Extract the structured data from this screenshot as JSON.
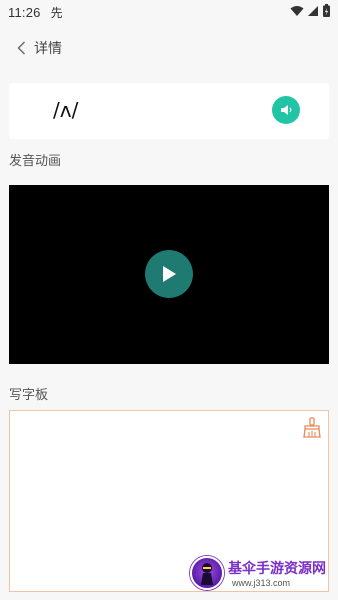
{
  "status": {
    "time": "11:26",
    "app_glyph": "先"
  },
  "nav": {
    "back_icon": "chevron-left-icon",
    "title": "详情"
  },
  "phonetic": {
    "symbol": "/ʌ/",
    "speaker_icon": "speaker-icon",
    "accent": "#21c4a5"
  },
  "animation_section": {
    "label": "发音动画",
    "play_icon": "play-icon",
    "play_color": "#1f7a72"
  },
  "writing_section": {
    "label": "写字板",
    "eraser_icon": "broom-icon",
    "border_color": "#efc4a6"
  },
  "watermark": {
    "title": "基伞手游资源网",
    "url": "www.j313.com"
  }
}
